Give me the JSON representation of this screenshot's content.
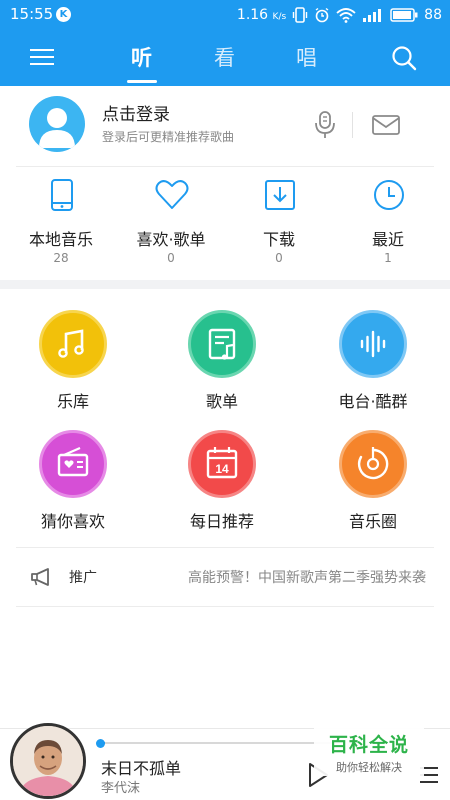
{
  "status_bar": {
    "time": "15:55",
    "k_badge": "K",
    "net_speed_value": "1.16",
    "net_speed_unit": "K/s",
    "battery": "88"
  },
  "nav": {
    "tabs": [
      {
        "label": "听",
        "active": true
      },
      {
        "label": "看",
        "active": false
      },
      {
        "label": "唱",
        "active": false
      }
    ],
    "menu_icon": "hamburger-menu-icon",
    "search_icon": "search-icon"
  },
  "profile": {
    "title": "点击登录",
    "subtitle": "登录后可更精准推荐歌曲",
    "avatar_icon": "default-user-avatar-icon",
    "mic_icon": "microphone-icon",
    "mail_icon": "mail-icon"
  },
  "quick_stats": [
    {
      "label": "本地音乐",
      "count": "28",
      "icon": "phone-icon"
    },
    {
      "label": "喜欢·歌单",
      "count": "0",
      "icon": "heart-icon"
    },
    {
      "label": "下载",
      "count": "0",
      "icon": "download-icon"
    },
    {
      "label": "最近",
      "count": "1",
      "icon": "clock-icon"
    }
  ],
  "features": [
    {
      "label": "乐库",
      "icon": "music-note-icon",
      "color": "#f2c10a",
      "ring": "#f7d54e"
    },
    {
      "label": "歌单",
      "icon": "playlist-icon",
      "color": "#27c08e",
      "ring": "#6ad6b0"
    },
    {
      "label": "电台·酷群",
      "icon": "radio-wave-icon",
      "color": "#34a9ee",
      "ring": "#7fc8f5"
    },
    {
      "label": "猜你喜欢",
      "icon": "radio-heart-icon",
      "color": "#d64fd6",
      "ring": "#e68ae6"
    },
    {
      "label": "每日推荐",
      "icon": "calendar-icon",
      "color": "#f24a4a",
      "ring": "#f68585"
    },
    {
      "label": "音乐圈",
      "icon": "music-disc-icon",
      "color": "#f5842b",
      "ring": "#f8ac6e"
    }
  ],
  "calendar_day": "14",
  "promo": {
    "label": "推广",
    "text": "高能预警！中国新歌声第二季强势来袭",
    "icon": "megaphone-icon"
  },
  "player": {
    "title": "末日不孤单",
    "artist": "李代沫",
    "progress": 0.02,
    "play_icon": "play-icon",
    "list_icon": "playlist-menu-icon"
  },
  "watermark": {
    "main": "百科全说",
    "sub": "助你轻松解决"
  },
  "colors": {
    "brand": "#1e9bf0",
    "text": "#222222",
    "muted": "#888888"
  }
}
